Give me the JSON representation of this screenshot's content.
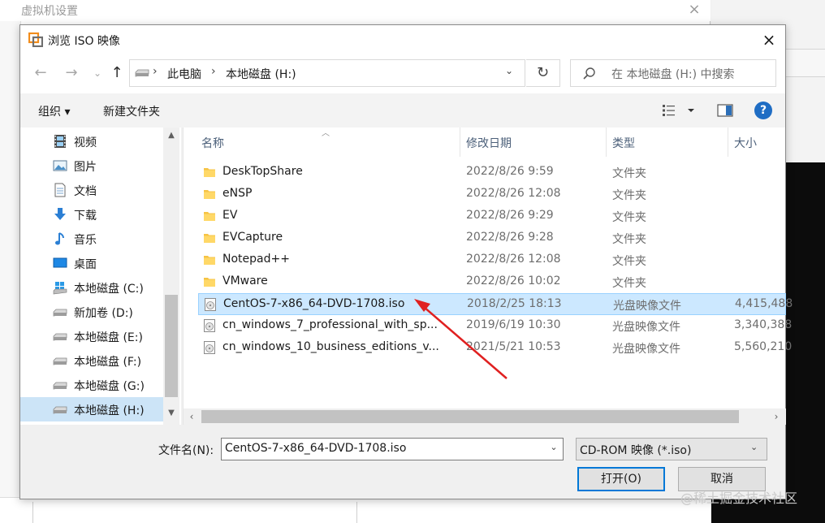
{
  "background_window": {
    "title": "虚拟机设置",
    "close_glyph": "×"
  },
  "dialog": {
    "title": "浏览 ISO 映像",
    "close_glyph": "×"
  },
  "address": {
    "back": "←",
    "forward": "→",
    "recent": "⌄",
    "up": "↑",
    "separator": "›",
    "parts": [
      "此电脑",
      "本地磁盘 (H:)"
    ],
    "dropdown": "⌄",
    "refresh": "↻",
    "search_placeholder": "在 本地磁盘 (H:) 中搜索"
  },
  "toolbar": {
    "organize": "组织 ▾",
    "new_folder": "新建文件夹",
    "help": "?"
  },
  "nav_pane": {
    "items": [
      {
        "label": "视频",
        "icon": "video-icon"
      },
      {
        "label": "图片",
        "icon": "pictures-icon"
      },
      {
        "label": "文档",
        "icon": "documents-icon"
      },
      {
        "label": "下载",
        "icon": "downloads-icon"
      },
      {
        "label": "音乐",
        "icon": "music-icon"
      },
      {
        "label": "桌面",
        "icon": "desktop-icon"
      },
      {
        "label": "本地磁盘 (C:)",
        "icon": "windows-drive-icon"
      },
      {
        "label": "新加卷 (D:)",
        "icon": "drive-icon"
      },
      {
        "label": "本地磁盘 (E:)",
        "icon": "drive-icon"
      },
      {
        "label": "本地磁盘 (F:)",
        "icon": "drive-icon"
      },
      {
        "label": "本地磁盘 (G:)",
        "icon": "drive-icon"
      },
      {
        "label": "本地磁盘 (H:)",
        "icon": "drive-icon",
        "selected": true
      }
    ]
  },
  "file_list": {
    "columns": [
      "名称",
      "修改日期",
      "类型",
      "大小"
    ],
    "rows": [
      {
        "name": "DeskTopShare",
        "date": "2022/8/26 9:59",
        "type": "文件夹",
        "size": "",
        "icon": "folder-icon"
      },
      {
        "name": "eNSP",
        "date": "2022/8/26 12:08",
        "type": "文件夹",
        "size": "",
        "icon": "folder-icon"
      },
      {
        "name": "EV",
        "date": "2022/8/26 9:29",
        "type": "文件夹",
        "size": "",
        "icon": "folder-icon"
      },
      {
        "name": "EVCapture",
        "date": "2022/8/26 9:28",
        "type": "文件夹",
        "size": "",
        "icon": "folder-icon"
      },
      {
        "name": "Notepad++",
        "date": "2022/8/26 12:08",
        "type": "文件夹",
        "size": "",
        "icon": "folder-icon"
      },
      {
        "name": "VMware",
        "date": "2022/8/26 10:02",
        "type": "文件夹",
        "size": "",
        "icon": "folder-icon"
      },
      {
        "name": "CentOS-7-x86_64-DVD-1708.iso",
        "date": "2018/2/25 18:13",
        "type": "光盘映像文件",
        "size": "4,415,488",
        "icon": "disc-image-icon",
        "selected": true
      },
      {
        "name": "cn_windows_7_professional_with_sp...",
        "date": "2019/6/19 10:30",
        "type": "光盘映像文件",
        "size": "3,340,388",
        "icon": "disc-image-icon"
      },
      {
        "name": "cn_windows_10_business_editions_v...",
        "date": "2021/5/21 10:53",
        "type": "光盘映像文件",
        "size": "5,560,210",
        "icon": "disc-image-icon"
      }
    ]
  },
  "bottom": {
    "filename_label": "文件名(N):",
    "filename_value": "CentOS-7-x86_64-DVD-1708.iso",
    "filetype_value": "CD-ROM 映像 (*.iso)",
    "open_button": "打开(O)",
    "cancel_button": "取消"
  },
  "watermark": "@稀土掘金技术社区",
  "colors": {
    "selection": "#cce8ff",
    "nav_selection": "#cce4f7",
    "accent": "#0078d7",
    "annotation_arrow": "#e02020"
  }
}
